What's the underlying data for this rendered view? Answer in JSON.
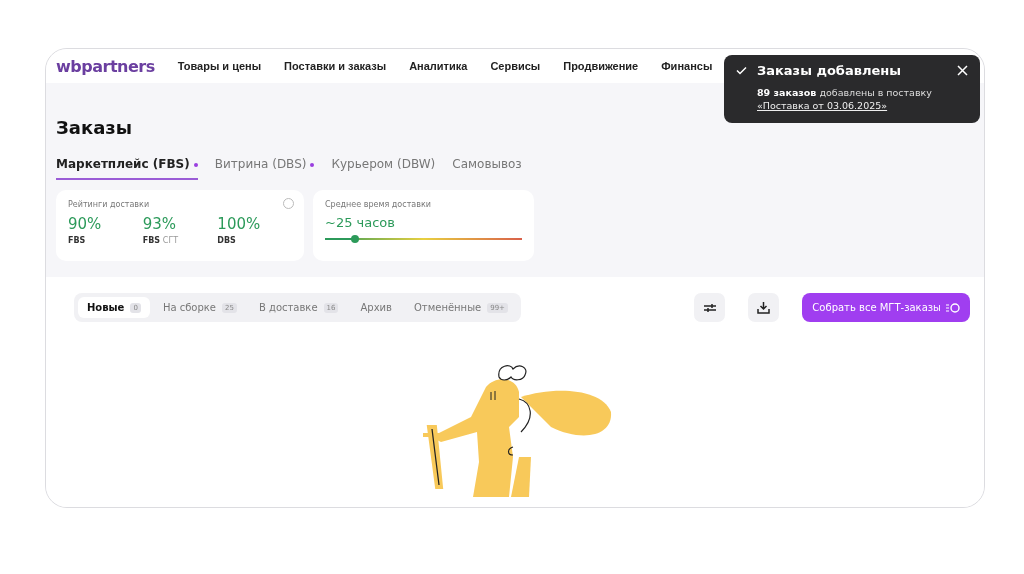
{
  "header": {
    "logo": "wbpartners",
    "nav": [
      "Товары и цены",
      "Поставки и заказы",
      "Аналитика",
      "Сервисы",
      "Продвижение",
      "Финансы"
    ]
  },
  "toast": {
    "title": "Заказы добавлены",
    "message": "**89 заказов** добавлены в поставку",
    "link": "«Поставка от 03.06.2025»"
  },
  "page_title": "Заказы",
  "tabs": [
    {
      "label": "Маркетплейс (FBS)",
      "selected": true,
      "dot": true
    },
    {
      "label": "Витрина (DBS)",
      "selected": false,
      "dot": true
    },
    {
      "label": "Курьером (DBW)",
      "selected": false,
      "dot": false
    },
    {
      "label": "Самовывоз",
      "selected": false,
      "dot": false
    }
  ],
  "ratings_card": {
    "title": "Рейтинги доставки",
    "ratings": [
      {
        "value": "90%",
        "label": "FBS"
      },
      {
        "value": "93%",
        "label": "FBS",
        "sublabel": "СГТ"
      },
      {
        "value": "100%",
        "label": "DBS"
      }
    ]
  },
  "delivery_card": {
    "title": "Среднее время доставки",
    "value": "~25 часов",
    "level": 0.15
  },
  "status_tabs": [
    {
      "label": "Новые",
      "count": "0",
      "selected": true
    },
    {
      "label": "На сборке",
      "count": "25",
      "selected": false
    },
    {
      "label": "В доставке",
      "count": "16",
      "selected": false
    },
    {
      "label": "Архив",
      "selected": false
    },
    {
      "label": "Отменённые",
      "count": "99+",
      "selected": false
    }
  ],
  "collect_button": "Собрать все МГТ-заказы"
}
